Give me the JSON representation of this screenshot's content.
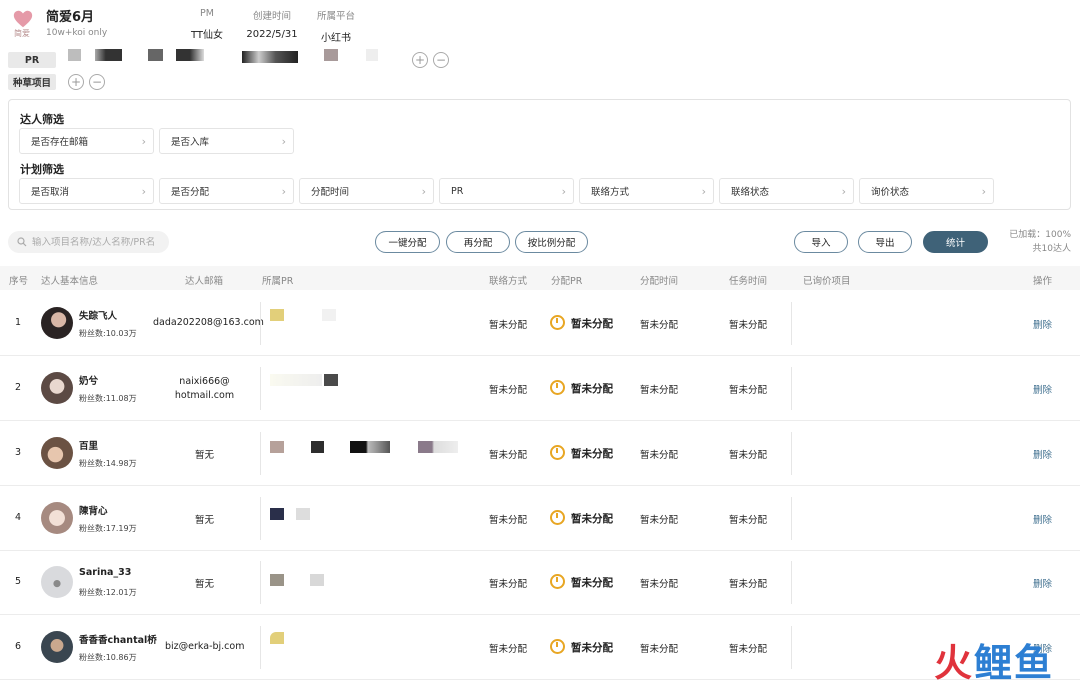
{
  "project": {
    "logo_text": "简爱",
    "name": "简爱6月",
    "tag": "10w+koi only"
  },
  "meta": [
    {
      "label": "PM",
      "value": "TT仙女"
    },
    {
      "label": "创建时间",
      "value": "2022/5/31"
    },
    {
      "label": "所属平台",
      "value": "小红书"
    }
  ],
  "pr_tag": "PR",
  "seed_tag": "种草项目",
  "add_icon": "plus-circle-icon",
  "remove_icon": "minus-circle-icon",
  "filters": {
    "kol_title": "达人筛选",
    "kol_items": [
      "是否存在邮箱",
      "是否入库"
    ],
    "plan_title": "计划筛选",
    "plan_items": [
      "是否取消",
      "是否分配",
      "分配时间",
      "PR",
      "联络方式",
      "联络状态",
      "询价状态"
    ]
  },
  "toolbar": {
    "search_placeholder": "输入项目名称/达人名称/PR名",
    "btn_one_click": "一键分配",
    "btn_reassign": "再分配",
    "btn_ratio": "按比例分配",
    "btn_import": "导入",
    "btn_export": "导出",
    "btn_stats": "统计",
    "loaded": "已加载：100%",
    "total": "共10达人"
  },
  "table": {
    "headers": [
      "序号",
      "达人基本信息",
      "达人邮箱",
      "所属PR",
      "联络方式",
      "分配PR",
      "分配时间",
      "任务时间",
      "已询价项目",
      "操作"
    ],
    "rows": [
      {
        "no": "1",
        "name": "失踪飞人",
        "fans": "粉丝数:10.03万",
        "email": "dada202208@163.com",
        "contact": "暂未分配",
        "assign_pr": "暂未分配",
        "assign_time": "暂未分配",
        "task_time": "暂未分配",
        "op": "删除"
      },
      {
        "no": "2",
        "name": "奶兮",
        "fans": "粉丝数:11.08万",
        "email": "naixi666@\nhotmail.com",
        "contact": "暂未分配",
        "assign_pr": "暂未分配",
        "assign_time": "暂未分配",
        "task_time": "暂未分配",
        "op": "删除"
      },
      {
        "no": "3",
        "name": "百里",
        "fans": "粉丝数:14.98万",
        "email": "暂无",
        "contact": "暂未分配",
        "assign_pr": "暂未分配",
        "assign_time": "暂未分配",
        "task_time": "暂未分配",
        "op": "删除"
      },
      {
        "no": "4",
        "name": "陳背心",
        "fans": "粉丝数:17.19万",
        "email": "暂无",
        "contact": "暂未分配",
        "assign_pr": "暂未分配",
        "assign_time": "暂未分配",
        "task_time": "暂未分配",
        "op": "删除"
      },
      {
        "no": "5",
        "name": "Sarina_33",
        "fans": "粉丝数:12.01万",
        "email": "暂无",
        "contact": "暂未分配",
        "assign_pr": "暂未分配",
        "assign_time": "暂未分配",
        "task_time": "暂未分配",
        "op": "删除"
      },
      {
        "no": "6",
        "name": "香香香chantal桥",
        "fans": "粉丝数:10.86万",
        "email": "biz@erka-bj.com",
        "contact": "暂未分配",
        "assign_pr": "暂未分配",
        "assign_time": "暂未分配",
        "task_time": "暂未分配",
        "op": "删除"
      }
    ]
  },
  "watermark": "火鲤鱼",
  "colors": {
    "primary": "#3f6278",
    "accent_pending": "#e8a623",
    "link": "#3f6f8f"
  }
}
